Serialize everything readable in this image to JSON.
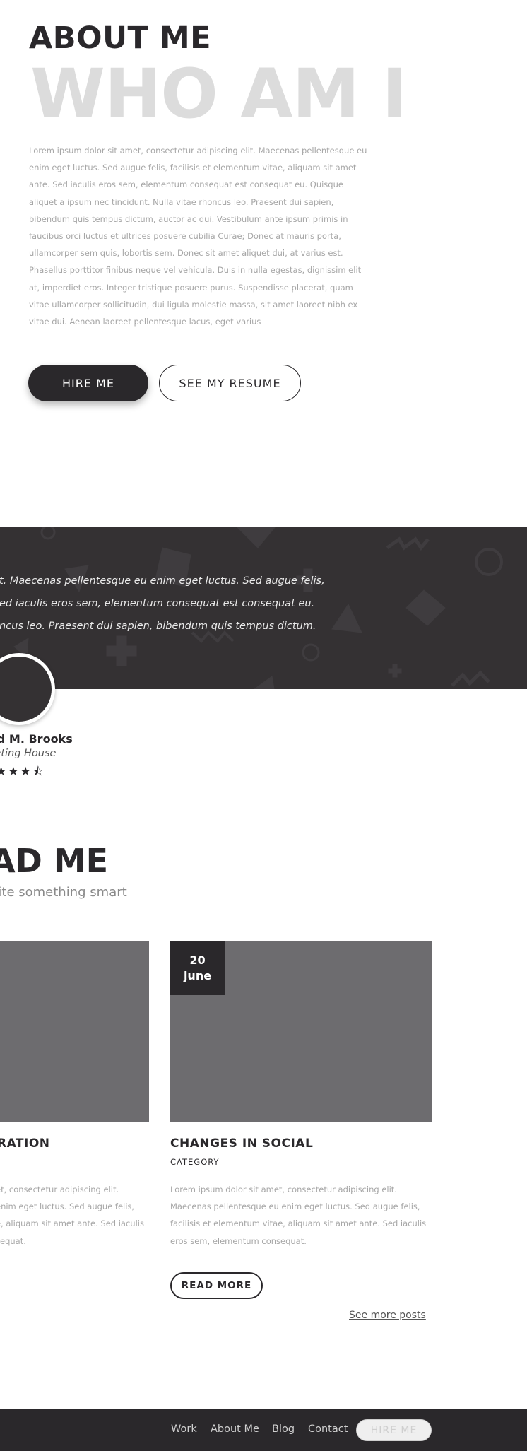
{
  "about": {
    "heading": "ABOUT ME",
    "big_heading": "WHO AM I",
    "paragraph": "Lorem ipsum dolor sit amet, consectetur adipiscing elit. Maecenas pellentesque eu enim eget luctus. Sed augue felis, facilisis et elementum vitae, aliquam sit amet ante. Sed iaculis eros sem, elementum consequat est consequat eu. Quisque aliquet a ipsum nec tincidunt. Nulla vitae rhoncus leo. Praesent dui sapien, bibendum quis tempus dictum, auctor ac dui. Vestibulum ante ipsum primis in faucibus orci luctus et ultrices posuere cubilia Curae; Donec at mauris porta, ullamcorper sem quis, lobortis sem. Donec sit amet aliquet dui, at varius est. Phasellus porttitor finibus neque vel vehicula. Duis in nulla egestas, dignissim elit at, imperdiet eros. Integer tristique posuere purus. Suspendisse placerat, quam vitae ullamcorper sollicitudin, dui ligula molestie massa, sit amet laoreet nibh ex vitae dui. Aenean laoreet pellentesque lacus, eget varius",
    "hire_label": "HIRE ME",
    "resume_label": "SEE MY RESUME"
  },
  "testimonial": {
    "quote_lines": [
      "t. Maecenas pellentesque eu enim eget luctus. Sed augue felis,",
      "ed iaculis eros sem, elementum consequat est consequat eu.",
      "ncus leo. Praesent dui sapien, bibendum quis tempus dictum."
    ],
    "name": "rd M. Brooks",
    "company": "keting House",
    "stars": "★★★⯪",
    "rating": 3.5
  },
  "blog": {
    "title": "AD ME",
    "subtitle": "rite something smart",
    "posts": [
      {
        "title": "RATION",
        "excerpt_lines": [
          "et, consectetur adipiscing elit.",
          " enim eget luctus. Sed augue felis,",
          "e, aliquam sit amet ante. Sed iaculis",
          "sequat."
        ]
      },
      {
        "date_day": "20",
        "date_month": "june",
        "title": "CHANGES IN SOCIAL",
        "category": "CATEGORY",
        "excerpt": "Lorem ipsum dolor sit amet, consectetur adipiscing elit. Maecenas pellentesque eu enim eget luctus. Sed augue felis, facilisis et elementum vitae, aliquam sit amet ante. Sed iaculis eros sem, elementum consequat.",
        "read_more_label": "READ MORE"
      }
    ],
    "see_more_label": "See more posts"
  },
  "footer": {
    "links": [
      "Work",
      "About Me",
      "Blog",
      "Contact"
    ],
    "hire_label": "HIRE ME"
  },
  "colors": {
    "dark": "#2a282b",
    "band": "#343133",
    "image_placeholder": "#6d6c6f",
    "muted_text": "#a6a6a6",
    "watermark_heading": "#dcdcdc"
  }
}
